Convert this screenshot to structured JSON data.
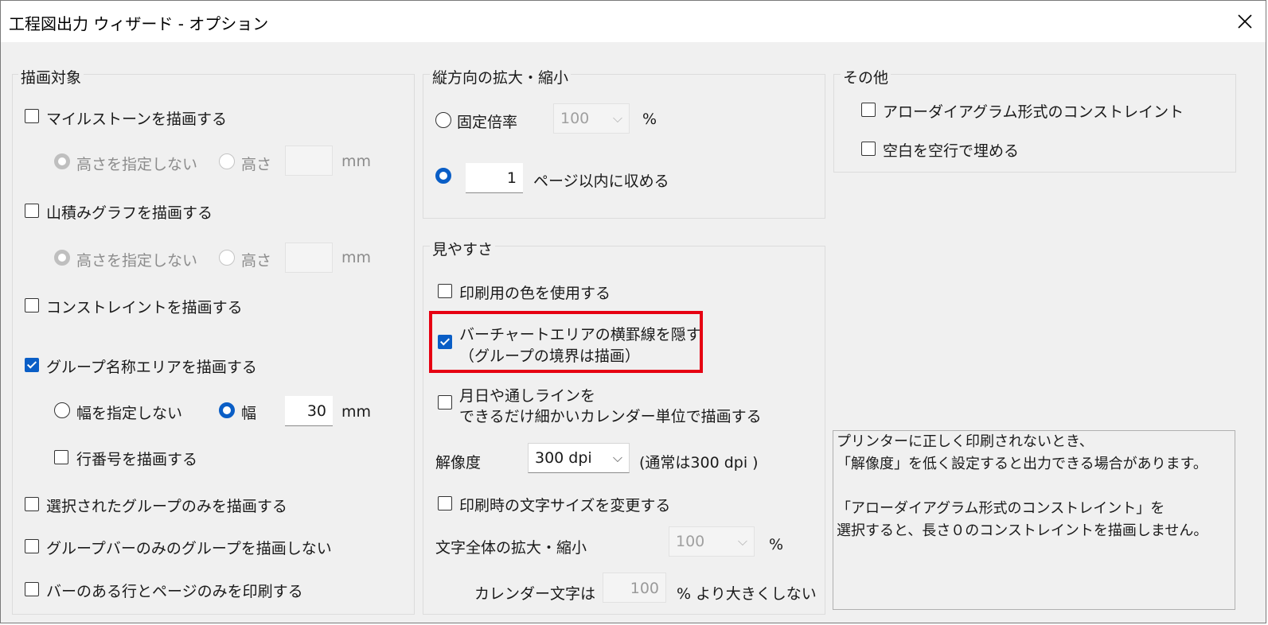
{
  "window": {
    "title": "工程図出力 ウィザード - オプション",
    "close_icon": "close-icon"
  },
  "draw_targets": {
    "label": "描画対象",
    "milestone": {
      "label": "マイルストーンを描画する",
      "checked": false,
      "no_height": "高さを指定しない",
      "height": "高さ",
      "height_value": "",
      "unit": "mm"
    },
    "yamazumi": {
      "label": "山積みグラフを描画する",
      "checked": false,
      "no_height": "高さを指定しない",
      "height": "高さ",
      "height_value": "",
      "unit": "mm"
    },
    "constraint": {
      "label": "コンストレイントを描画する",
      "checked": false
    },
    "group_name": {
      "label": "グループ名称エリアを描画する",
      "checked": true,
      "no_width": "幅を指定しない",
      "width": "幅",
      "width_value": "30",
      "unit": "mm",
      "row_number": "行番号を描画する"
    },
    "selected_only": "選択されたグループのみを描画する",
    "no_group_bar_only": "グループバーのみのグループを描画しない",
    "bar_rows_only": "バーのある行とページのみを印刷する"
  },
  "vertical_scale": {
    "label": "縦方向の拡大・縮小",
    "fixed_rate": "固定倍率",
    "fixed_value": "100",
    "percent": "%",
    "pages_value": "1",
    "pages_label": "ページ以内に収める"
  },
  "readability": {
    "label": "見やすさ",
    "print_colors": "印刷用の色を使用する",
    "hide_lines_1": "バーチャートエリアの横罫線を隠す",
    "hide_lines_2": "（グループの境界は描画）",
    "calendar_1": "月日や通しラインを",
    "calendar_2": "できるだけ細かいカレンダー単位で描画する",
    "resolution_label": "解像度",
    "resolution_value": "300 dpi",
    "resolution_note": "(通常は300 dpi )",
    "change_font": "印刷時の文字サイズを変更する",
    "text_scale_label": "文字全体の拡大・縮小",
    "text_scale_value": "100",
    "percent": "%",
    "calendar_text_label": "カレンダー文字は",
    "calendar_text_value": "100",
    "calendar_text_suffix": "% より大きくしない"
  },
  "other": {
    "label": "その他",
    "arrow_diagram": "アローダイアグラム形式のコンストレイント",
    "fill_blank": "空白を空行で埋める"
  },
  "info": {
    "line1": "プリンターに正しく印刷されないとき、",
    "line2": "「解像度」を低く設定すると出力できる場合があります。",
    "line3": "",
    "line4": "「アローダイアグラム形式のコンストレイント」を",
    "line5": "選択すると、長さ０のコンストレイントを描画しません。"
  },
  "colors": {
    "accent": "#0a5ec6",
    "highlight": "#e60012"
  }
}
